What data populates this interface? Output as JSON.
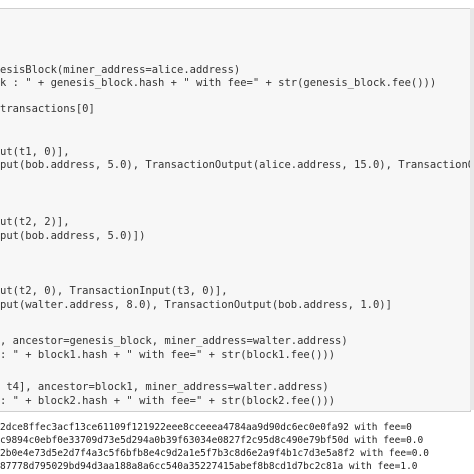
{
  "code_cell": {
    "lines": [
      "esisBlock(miner_address=alice.address)",
      "k : \" + genesis_block.hash + \" with fee=\" + str(genesis_block.fee()))",
      "",
      "transactions[0]",
      "",
      "",
      "ut(t1, 0)],",
      "put(bob.address, 5.0), TransactionOutput(alice.address, 15.0), TransactionOutput(walte",
      "",
      "",
      "",
      "ut(t2, 2)],",
      "put(bob.address, 5.0)])",
      "",
      "",
      "",
      "ut(t2, 0), TransactionInput(t3, 0)],",
      "put(walter.address, 8.0), TransactionOutput(bob.address, 1.0)]",
      "",
      ", ancestor=genesis_block, miner_address=walter.address)",
      ": \" + block1.hash + \" with fee=\" + str(block1.fee()))",
      "",
      " t4], ancestor=block1, miner_address=walter.address)",
      ": \" + block2.hash + \" with fee=\" + str(block2.fee()))"
    ]
  },
  "output": {
    "lines": [
      "2dce8ffec3acf13ce61109f121922eee8cceeea4784aa9d90dc6ec0e0fa92 with fee=0",
      "c9894c0ebf0e33709d73e5d294a0b39f63034e0827f2c95d8c490e79bf50d with fee=0.0",
      "2b0e4e73d5e2d7f4a3c5f6bfb8e4c9d2a1e5f7b3c8d6e2a9f4b1c7d3e5a8f2 with fee=0.0",
      "87778d795029bd94d3aa188a8a6cc540a35227415abef8b8cd1d7bc2c81a with fee=1.0"
    ]
  }
}
